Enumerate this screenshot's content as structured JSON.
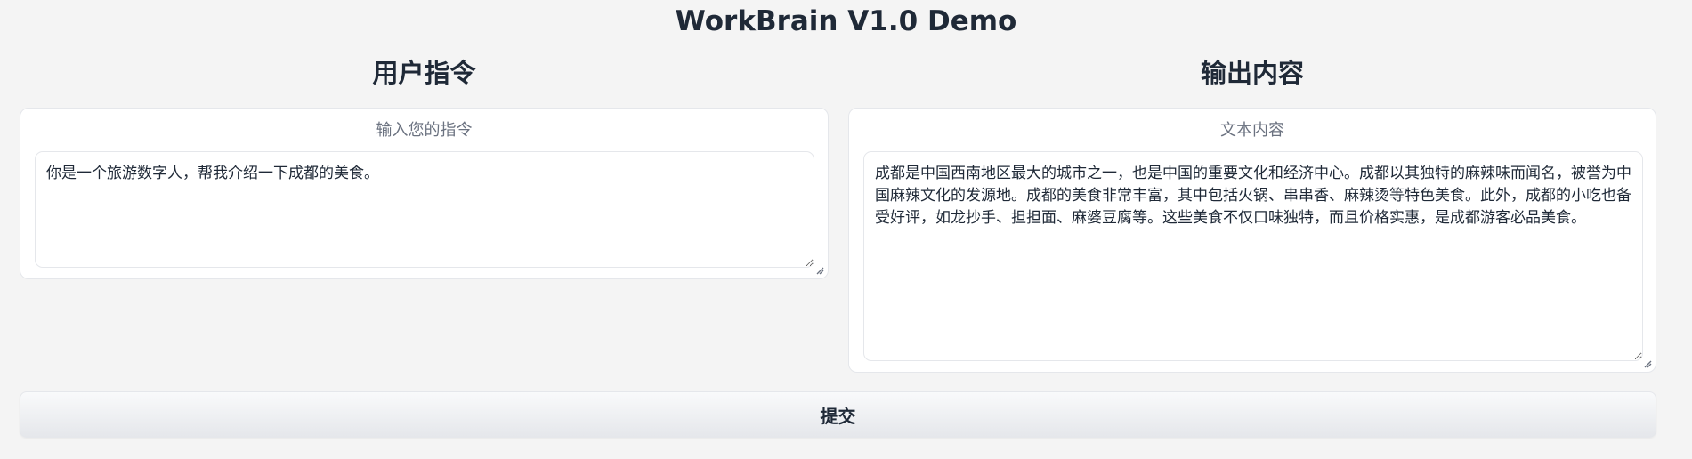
{
  "app": {
    "title": "WorkBrain V1.0 Demo"
  },
  "input_panel": {
    "heading": "用户指令",
    "label": "输入您的指令",
    "value": "你是一个旅游数字人，帮我介绍一下成都的美食。"
  },
  "output_panel": {
    "heading": "输出内容",
    "label": "文本内容",
    "value": "成都是中国西南地区最大的城市之一，也是中国的重要文化和经济中心。成都以其独特的麻辣味而闻名，被誉为中国麻辣文化的发源地。成都的美食非常丰富，其中包括火锅、串串香、麻辣烫等特色美食。此外，成都的小吃也备受好评，如龙抄手、担担面、麻婆豆腐等。这些美食不仅口味独特，而且价格实惠，是成都游客必品美食。"
  },
  "actions": {
    "submit_label": "提交"
  },
  "colors": {
    "background": "#f4f4f4",
    "panel": "#ffffff",
    "border": "#e5e7eb",
    "text": "#1f2937",
    "muted": "#6b7280"
  },
  "icons": {
    "resize_handle": "resize-handle-icon"
  }
}
